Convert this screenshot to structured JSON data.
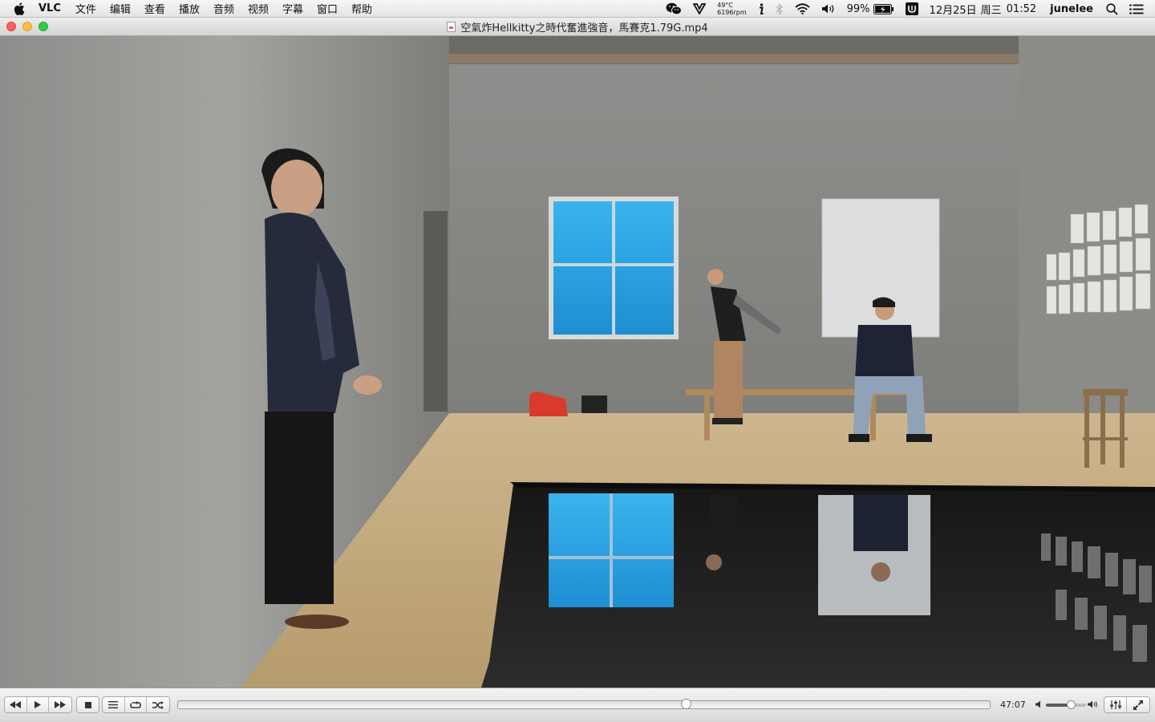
{
  "menubar": {
    "app_name": "VLC",
    "menus": [
      "文件",
      "编辑",
      "查看",
      "播放",
      "音频",
      "视频",
      "字幕",
      "窗口",
      "帮助"
    ],
    "status": {
      "temperature": "49°C",
      "fan_speed": "6196rpm",
      "battery": "99%",
      "date": "12月25日",
      "weekday": "周三",
      "time": "01:52",
      "user": "junelee"
    },
    "icons": [
      "apple-icon",
      "wechat-icon",
      "vivaldi-icon",
      "info-icon",
      "bluetooth-icon",
      "wifi-icon",
      "volume-icon",
      "battery-icon",
      "input-method-icon",
      "spotlight-icon",
      "notification-icon"
    ]
  },
  "window": {
    "title": "空氣炸Hellkitty之時代奮進強音，馬賽克1.79G.mp4"
  },
  "controls": {
    "elapsed": "47:07",
    "playback_position": 0.625,
    "volume_level": 0.62,
    "buttons": [
      "rewind-icon",
      "play-icon",
      "fast-forward-icon",
      "stop-icon",
      "playlist-icon",
      "loop-icon",
      "shuffle-icon",
      "equalizer-icon",
      "fullscreen-icon"
    ]
  },
  "colors": {
    "traffic_close": "#fc605c",
    "traffic_minimize": "#fdbc40",
    "traffic_maximize": "#34c84a",
    "window_blue": "#2aa9e6"
  }
}
